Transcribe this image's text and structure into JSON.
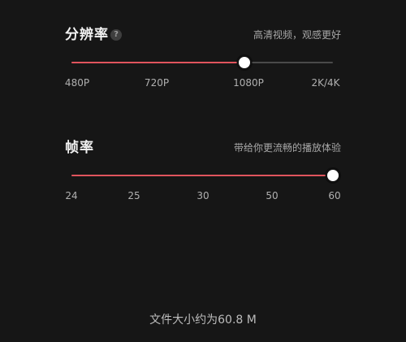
{
  "resolution": {
    "title": "分辨率",
    "help_icon": "?",
    "hint": "高清视频，观感更好",
    "options": [
      "480P",
      "720P",
      "1080P",
      "2K/4K"
    ],
    "selected_index": 2,
    "selected_value": "1080P"
  },
  "framerate": {
    "title": "帧率",
    "hint": "带给你更流畅的播放体验",
    "options": [
      "24",
      "25",
      "30",
      "50",
      "60"
    ],
    "selected_index": 4,
    "selected_value": "60"
  },
  "footer": {
    "file_size": "文件大小约为60.8 M"
  },
  "colors": {
    "background": "#161616",
    "accent": "#e0545d",
    "track": "#4a4a4a",
    "thumb": "#ffffff"
  },
  "icons": {
    "help": "help-icon"
  }
}
